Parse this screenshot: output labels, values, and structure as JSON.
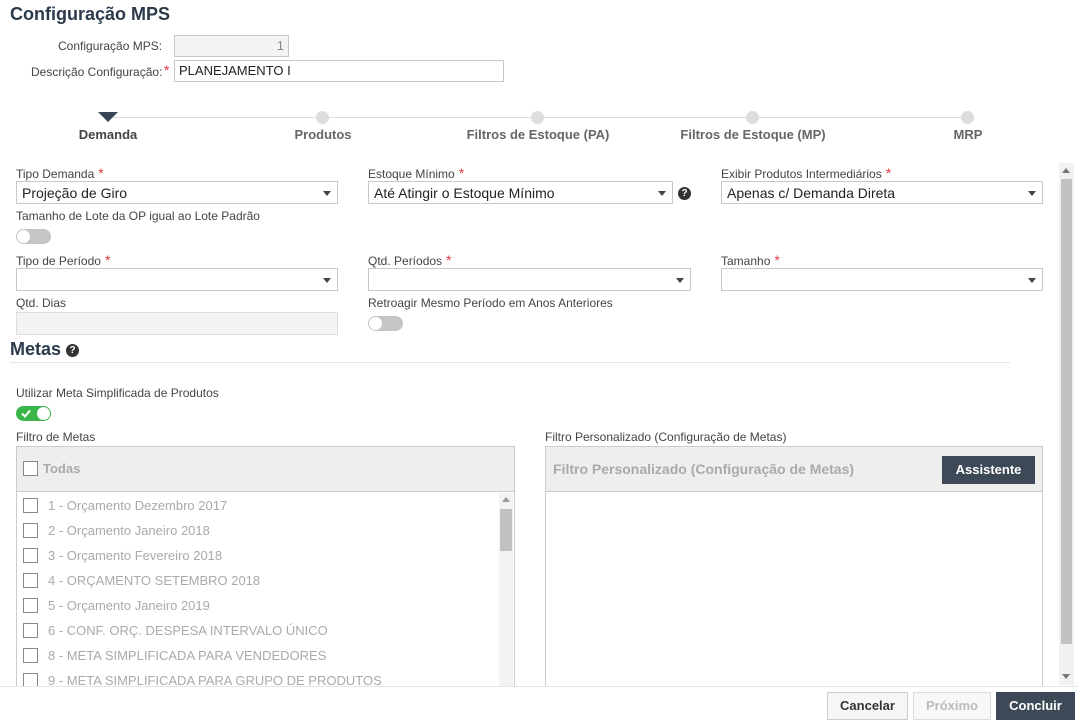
{
  "page": {
    "title": "Configuração MPS"
  },
  "config": {
    "mps_label": "Configuração MPS:",
    "mps_value": "1",
    "desc_label": "Descrição Configuração:",
    "desc_value": "PLANEJAMENTO I",
    "required_mark": "*"
  },
  "steps": [
    "Demanda",
    "Produtos",
    "Filtros de Estoque (PA)",
    "Filtros de Estoque (MP)",
    "MRP"
  ],
  "form": {
    "tipo_demanda_label": "Tipo Demanda",
    "tipo_demanda_value": "Projeção de Giro",
    "estoque_minimo_label": "Estoque Mínimo",
    "estoque_minimo_value": "Até Atingir o Estoque Mínimo",
    "exibir_label": "Exibir Produtos Intermediários",
    "exibir_value": "Apenas c/ Demanda Direta",
    "tamanho_lote_label": "Tamanho de Lote da OP igual ao Lote Padrão",
    "tipo_periodo_label": "Tipo de Período",
    "tipo_periodo_value": "",
    "qtd_periodos_label": "Qtd. Períodos",
    "qtd_periodos_value": "",
    "tamanho_label": "Tamanho",
    "tamanho_value": "",
    "qtd_dias_label": "Qtd. Dias",
    "retroagir_label": "Retroagir Mesmo Período em Anos Anteriores",
    "help_glyph": "?"
  },
  "metas": {
    "title": "Metas",
    "utilizar_label": "Utilizar Meta Simplificada de Produtos",
    "filtro_label": "Filtro de Metas",
    "todas": "Todas",
    "items": [
      "1 - Orçamento Dezembro 2017",
      "2 - Orçamento Janeiro 2018",
      "3 - Orçamento Fevereiro 2018",
      "4 - ORÇAMENTO SETEMBRO 2018",
      "5 - Orçamento Janeiro 2019",
      "6 - CONF. ORÇ. DESPESA INTERVALO ÚNICO",
      "8 - META SIMPLIFICADA PARA VENDEDORES",
      "9 - META SIMPLIFICADA PARA GRUPO DE PRODUTOS"
    ],
    "filtro_personalizado_label": "Filtro Personalizado (Configuração de Metas)",
    "filtro_personalizado_header": "Filtro Personalizado (Configuração de Metas)",
    "assistente": "Assistente"
  },
  "footer": {
    "cancelar": "Cancelar",
    "proximo": "Próximo",
    "concluir": "Concluir"
  }
}
